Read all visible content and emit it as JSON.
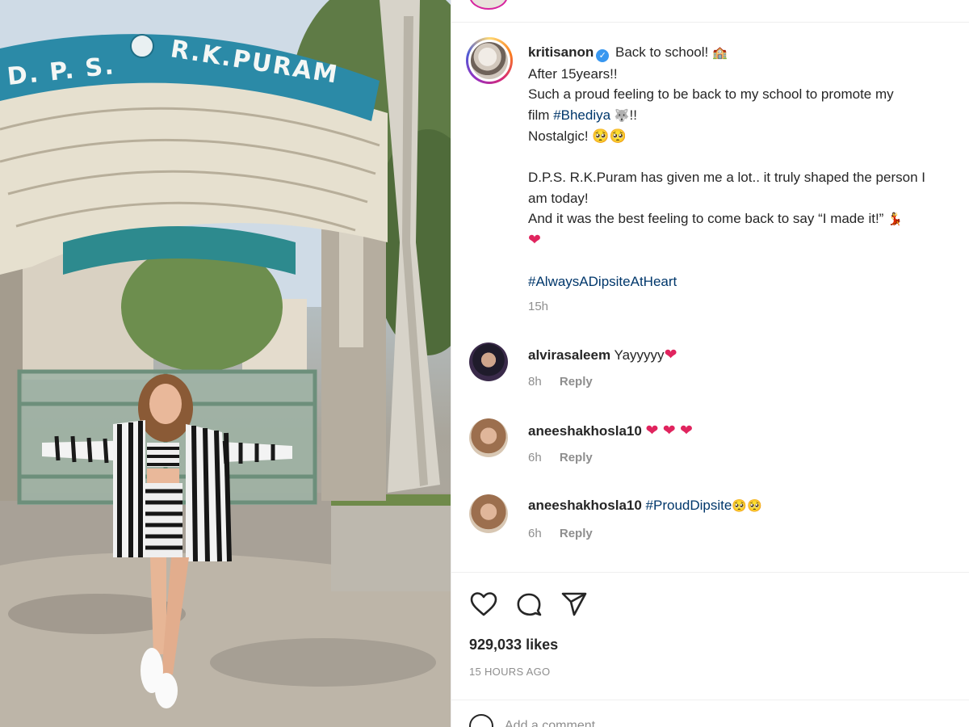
{
  "photo": {
    "sign_left": "D. P. S.",
    "sign_right": "R.K.PURAM"
  },
  "post": {
    "username": "kritisanon",
    "verified_mark": "✓",
    "caption_lines": {
      "l1": "Back to school!",
      "l1_emoji": "🏫",
      "l2": "After 15years!!",
      "l3": "Such a proud feeling to be back to my school to promote my",
      "l4_prefix": "film",
      "l4_tag": "#Bhediya",
      "l4_emoji": "🐺",
      "l4_suffix": "!!",
      "l5": "Nostalgic! 🥺🥺",
      "l6": "D.P.S. R.K.Puram has given me a lot.. it truly shaped the person I",
      "l7": "am today!",
      "l8": "And it was the best feeling to come back to say “I made it!”",
      "l8_emoji": "💃",
      "l9_emoji": "❤",
      "hashtag": "#AlwaysADipsiteAtHeart"
    },
    "time": "15h"
  },
  "comments": [
    {
      "user": "alvirasaleem",
      "text": "Yayyyyy",
      "emoji": "❤",
      "time": "8h",
      "reply": "Reply"
    },
    {
      "user": "aneeshakhosla10",
      "text": "",
      "emoji": "❤ ❤ ❤",
      "time": "6h",
      "reply": "Reply"
    },
    {
      "user": "aneeshakhosla10",
      "text": "#ProudDipsite",
      "emoji": "🥺🥺",
      "time": "6h",
      "reply": "Reply"
    }
  ],
  "actions": {
    "like_icon": "heart-outline-icon",
    "comment_icon": "speech-bubble-icon",
    "share_icon": "paper-plane-icon"
  },
  "likes": "929,033 likes",
  "posted_ago": "15 HOURS AGO",
  "add_comment_placeholder": "Add a comment…",
  "colors": {
    "link": "#00376b",
    "muted": "#8e8e8e",
    "verified": "#3897f0",
    "heart": "#e0245e"
  }
}
